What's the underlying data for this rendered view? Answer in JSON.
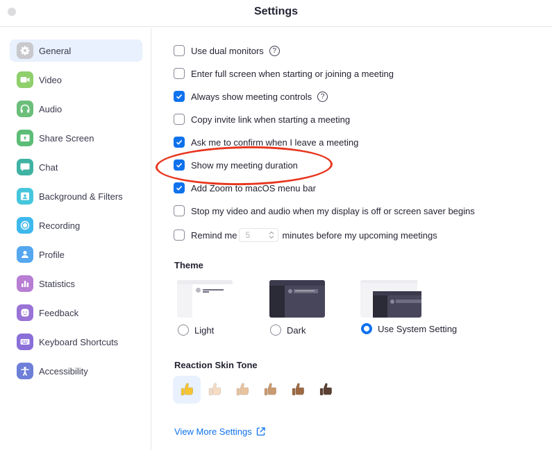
{
  "window": {
    "title": "Settings"
  },
  "sidebar": {
    "items": [
      {
        "label": "General",
        "icon": "gear-icon",
        "color": "#c8c8cd",
        "active": true
      },
      {
        "label": "Video",
        "icon": "video-camera-icon",
        "color": "#8fcf6c"
      },
      {
        "label": "Audio",
        "icon": "headphones-icon",
        "color": "#6bbf7a"
      },
      {
        "label": "Share Screen",
        "icon": "share-screen-icon",
        "color": "#5cbd76"
      },
      {
        "label": "Chat",
        "icon": "chat-bubble-icon",
        "color": "#3fb3a3"
      },
      {
        "label": "Background & Filters",
        "icon": "background-person-icon",
        "color": "#45c6dc"
      },
      {
        "label": "Recording",
        "icon": "record-icon",
        "color": "#3eb9ee"
      },
      {
        "label": "Profile",
        "icon": "profile-person-icon",
        "color": "#55a7f0"
      },
      {
        "label": "Statistics",
        "icon": "bar-chart-icon",
        "color": "#b77ed4"
      },
      {
        "label": "Feedback",
        "icon": "smiley-icon",
        "color": "#9a73d6"
      },
      {
        "label": "Keyboard Shortcuts",
        "icon": "keyboard-icon",
        "color": "#8a6fd9"
      },
      {
        "label": "Accessibility",
        "icon": "accessibility-person-icon",
        "color": "#6d7fd8"
      }
    ]
  },
  "general": {
    "options": [
      {
        "label": "Use dual monitors",
        "checked": false,
        "help": true
      },
      {
        "label": "Enter full screen when starting or joining a meeting",
        "checked": false
      },
      {
        "label": "Always show meeting controls",
        "checked": true,
        "help": true
      },
      {
        "label": "Copy invite link when starting a meeting",
        "checked": false
      },
      {
        "label": "Ask me to confirm when I leave a meeting",
        "checked": true
      },
      {
        "label": "Show my meeting duration",
        "checked": true,
        "highlighted": true
      },
      {
        "label": "Add Zoom to macOS menu bar",
        "checked": true
      },
      {
        "label": "Stop my video and audio when my display is off or screen saver begins",
        "checked": false
      }
    ],
    "reminder": {
      "label_before": "Remind me",
      "value": "5",
      "label_after": "minutes before my upcoming meetings",
      "checked": false
    },
    "help_glyph": "?"
  },
  "theme": {
    "title": "Theme",
    "options": [
      {
        "label": "Light",
        "selected": false
      },
      {
        "label": "Dark",
        "selected": false
      },
      {
        "label": "Use System Setting",
        "selected": true
      }
    ]
  },
  "skin_tone": {
    "title": "Reaction Skin Tone",
    "tones": [
      "#f7c531",
      "#f6dcc3",
      "#e8c39e",
      "#c99a6f",
      "#9b6a43",
      "#5b4033"
    ],
    "selected_index": 0
  },
  "links": {
    "view_more": "View More Settings"
  },
  "colors": {
    "accent": "#0e72ed",
    "annotation": "#e8361e"
  }
}
